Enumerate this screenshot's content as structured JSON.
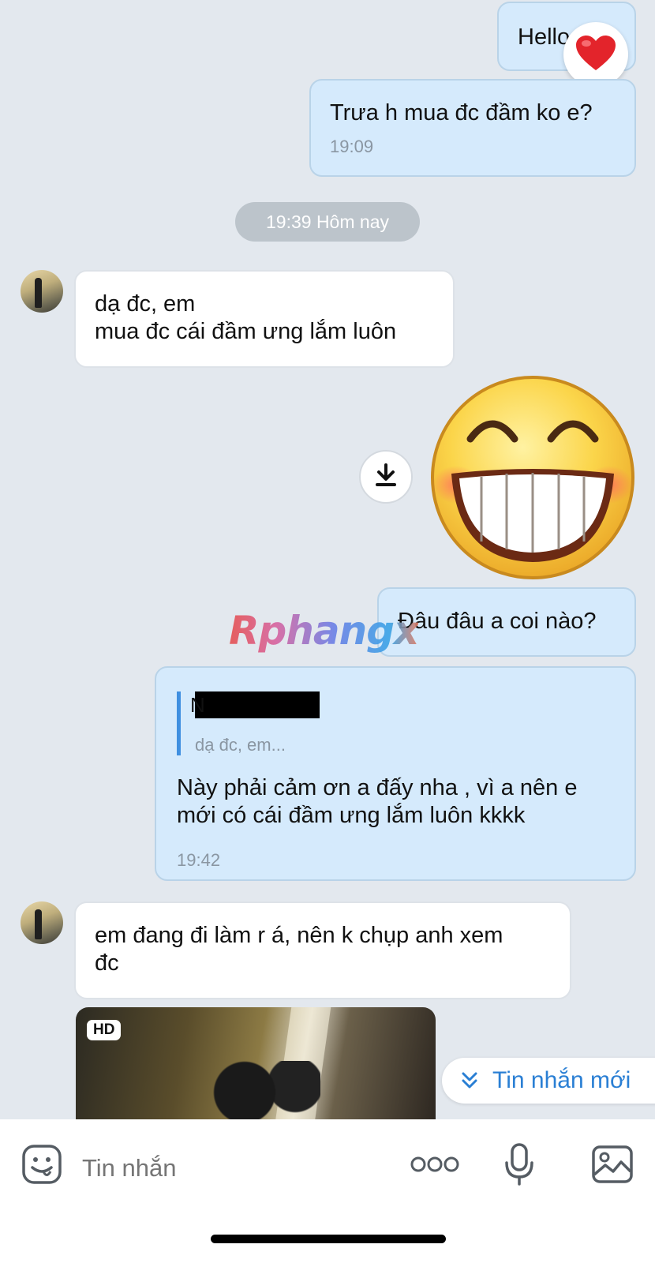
{
  "messages": {
    "m1": {
      "text": "Hello"
    },
    "m2": {
      "text": "Trưa h mua đc đầm ko e?",
      "time": "19:09"
    },
    "date_separator": "19:39 Hôm nay",
    "m3": {
      "line1": "dạ đc, em",
      "line2": "mua đc cái đầm ưng lắm luôn"
    },
    "m4": {
      "text": "Đâu đâu a coi nào?"
    },
    "m5": {
      "quote_preview": "dạ đc, em...",
      "line1": "Này phải cảm ơn a đấy nha , vì a nên e",
      "line2": "mới có cái đầm ưng lắm luôn kkkk",
      "time": "19:42"
    },
    "m6": {
      "line1": "em đang đi làm r á, nên k chụp anh xem",
      "line2": "đc"
    },
    "photo_badge": "HD"
  },
  "watermark": "Rphangx",
  "new_messages_button": "Tin nhắn mới",
  "composer": {
    "placeholder": "Tin nhắn"
  },
  "icons": {
    "reaction": "heart-icon",
    "download": "download-icon",
    "sticker": "grinning-face-sticker",
    "emoji": "emoji-icon",
    "more": "more-icon",
    "mic": "microphone-icon",
    "gallery": "image-icon"
  },
  "colors": {
    "chat_background": "#e3e8ee",
    "outgoing_bubble": "#d5eafc",
    "incoming_bubble": "#ffffff",
    "accent": "#2a7fd4"
  }
}
